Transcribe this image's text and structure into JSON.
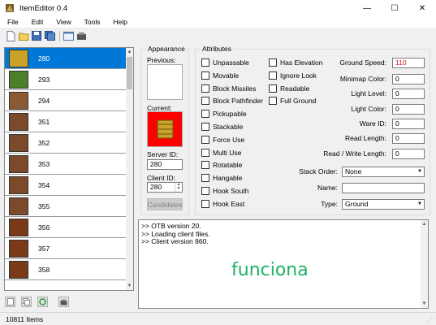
{
  "window": {
    "title": "ItemEditor 0.4",
    "minimize_glyph": "—",
    "maximize_glyph": "☐",
    "close_glyph": "✕"
  },
  "menu": [
    "File",
    "Edit",
    "View",
    "Tools",
    "Help"
  ],
  "toolbar_icons": [
    "new-icon",
    "open-icon",
    "save-icon",
    "save-as-icon",
    "compare-icon",
    "reload-icon"
  ],
  "item_list": {
    "items": [
      {
        "id": "280",
        "thumb": "#c9a227",
        "selected": true
      },
      {
        "id": "293",
        "thumb": "#4b7f2a",
        "selected": false
      },
      {
        "id": "294",
        "thumb": "#8a5a35",
        "selected": false
      },
      {
        "id": "351",
        "thumb": "#7a4a2a",
        "selected": false
      },
      {
        "id": "352",
        "thumb": "#7a4a2a",
        "selected": false
      },
      {
        "id": "353",
        "thumb": "#7a4a2a",
        "selected": false
      },
      {
        "id": "354",
        "thumb": "#7a4a2a",
        "selected": false
      },
      {
        "id": "355",
        "thumb": "#7a4a2a",
        "selected": false
      },
      {
        "id": "356",
        "thumb": "#7a3a1a",
        "selected": false
      },
      {
        "id": "357",
        "thumb": "#7a3a1a",
        "selected": false
      },
      {
        "id": "358",
        "thumb": "#7a3a1a",
        "selected": false
      }
    ]
  },
  "status": {
    "count": "10811 Items"
  },
  "appearance": {
    "legend": "Appearance",
    "previous_label": "Previous:",
    "current_label": "Current:",
    "server_id_label": "Server ID:",
    "server_id": "280",
    "client_id_label": "Client ID:",
    "client_id": "280",
    "candidates_label": "Candidates"
  },
  "attributes": {
    "legend": "Attributes",
    "col1": [
      "Unpassable",
      "Movable",
      "Block Missiles",
      "Block Pathfinder",
      "Pickupable",
      "Stackable",
      "Force Use",
      "Multi Use",
      "Rotatable",
      "Hangable",
      "Hook South",
      "Hook East"
    ],
    "col2": [
      "Has Elevation",
      "Ignore Look",
      "Readable",
      "Full Ground"
    ],
    "fields": {
      "ground_speed_label": "Ground Speed:",
      "ground_speed": "110",
      "minimap_color_label": "Minimap Color:",
      "minimap_color": "0",
      "light_level_label": "Light Level:",
      "light_level": "0",
      "light_color_label": "Light Color:",
      "light_color": "0",
      "ware_id_label": "Ware ID:",
      "ware_id": "0",
      "read_length_label": "Read Length:",
      "read_length": "0",
      "rw_length_label": "Read / Write Length:",
      "rw_length": "0",
      "stack_order_label": "Stack Order:",
      "stack_order": "None",
      "name_label": "Name:",
      "name": "",
      "type_label": "Type:",
      "type": "Ground"
    }
  },
  "console": {
    "lines": [
      ">> OTB version 20.",
      ">> Loading client files.",
      ">> Client version 860."
    ],
    "overlay_text": "funciona"
  },
  "colors": {
    "selection": "#0078d7",
    "current_bg": "#ff0000",
    "overlay": "#1db364",
    "ground_speed": "#e81123"
  }
}
